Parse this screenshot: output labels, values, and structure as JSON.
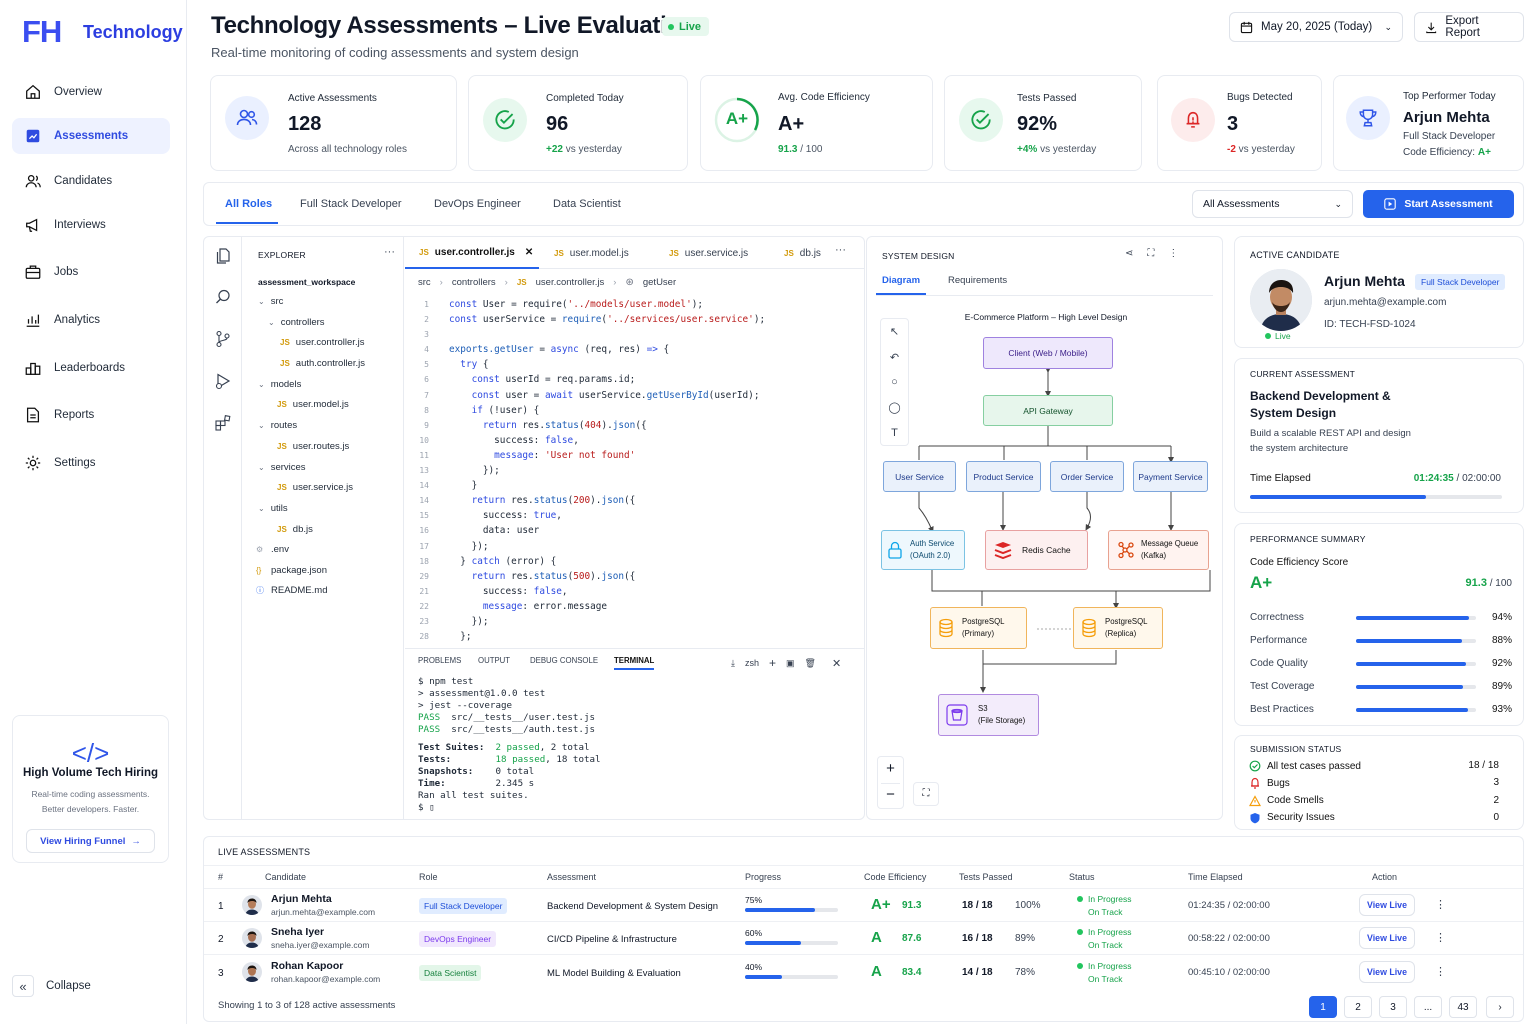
{
  "brand": {
    "logo_letters": "FH",
    "name": "Technology"
  },
  "sidebar": {
    "items": [
      {
        "label": "Overview",
        "icon": "home-icon"
      },
      {
        "label": "Assessments",
        "icon": "assessments-icon"
      },
      {
        "label": "Candidates",
        "icon": "users-icon"
      },
      {
        "label": "Interviews",
        "icon": "megaphone-icon"
      },
      {
        "label": "Jobs",
        "icon": "briefcase-icon"
      },
      {
        "label": "Analytics",
        "icon": "analytics-icon"
      },
      {
        "label": "Leaderboards",
        "icon": "leaderboard-icon"
      },
      {
        "label": "Reports",
        "icon": "report-icon"
      },
      {
        "label": "Settings",
        "icon": "gear-icon"
      }
    ],
    "promo": {
      "code": "</>",
      "title": "High Volume Tech Hiring",
      "line1": "Real-time coding assessments.",
      "line2": "Better developers. Faster.",
      "button": "View Hiring Funnel"
    },
    "collapse": "Collapse"
  },
  "header": {
    "title": "Technology Assessments – Live Evaluation",
    "live": "Live",
    "subtitle": "Real-time monitoring of coding assessments and system design",
    "date": "May 20, 2025 (Today)",
    "export": "Export Report"
  },
  "stats": {
    "active": {
      "label": "Active Assessments",
      "value": "128",
      "sub": "Across all technology roles"
    },
    "completed": {
      "label": "Completed Today",
      "value": "96",
      "delta": "+22",
      "sub": " vs yesterday"
    },
    "efficiency": {
      "label": "Avg. Code Efficiency",
      "value": "A+",
      "score": "91.3",
      "max": " / 100",
      "grade": "A+"
    },
    "tests": {
      "label": "Tests Passed",
      "value": "92%",
      "delta": "+4%",
      "sub": " vs yesterday"
    },
    "bugs": {
      "label": "Bugs Detected",
      "value": "3",
      "delta": "-2",
      "sub": " vs yesterday"
    },
    "top": {
      "label": "Top Performer Today",
      "name": "Arjun Mehta",
      "role": "Full Stack Developer",
      "eff_label": "Code Efficiency: ",
      "eff": "A+"
    }
  },
  "tabs": [
    "All Roles",
    "Full Stack Developer",
    "DevOps Engineer",
    "Data Scientist"
  ],
  "filter": "All Assessments",
  "start_btn": "Start Assessment",
  "explorer": {
    "title": "EXPLORER",
    "root": "assessment_workspace",
    "items": [
      {
        "t": "src",
        "kind": "folder",
        "lvl": 0
      },
      {
        "t": "controllers",
        "kind": "folder",
        "lvl": 1
      },
      {
        "t": "user.controller.js",
        "kind": "js",
        "lvl": 2
      },
      {
        "t": "auth.controller.js",
        "kind": "js",
        "lvl": 2
      },
      {
        "t": "models",
        "kind": "folder",
        "lvl": 0
      },
      {
        "t": "user.model.js",
        "kind": "js",
        "lvl": 1
      },
      {
        "t": "routes",
        "kind": "folder",
        "lvl": 0
      },
      {
        "t": "user.routes.js",
        "kind": "js",
        "lvl": 1
      },
      {
        "t": "services",
        "kind": "folder",
        "lvl": 0
      },
      {
        "t": "user.service.js",
        "kind": "js",
        "lvl": 1
      },
      {
        "t": "utils",
        "kind": "folder",
        "lvl": 0
      },
      {
        "t": "db.js",
        "kind": "js",
        "lvl": 1
      },
      {
        "t": ".env",
        "kind": "env",
        "lvl": -1
      },
      {
        "t": "package.json",
        "kind": "json",
        "lvl": -1
      },
      {
        "t": "README.md",
        "kind": "md",
        "lvl": -1
      }
    ]
  },
  "editor": {
    "tabs": [
      "user.controller.js",
      "user.model.js",
      "user.service.js",
      "db.js"
    ],
    "js_badge": "JS",
    "crumbs": [
      "src",
      "controllers",
      "user.controller.js",
      "getUser"
    ],
    "lines": [
      {
        "n": "1",
        "h": "<span class='kw'>const</span> User = require(<span class='st'>'../models/user.model'</span>);"
      },
      {
        "n": "2",
        "h": "<span class='kw'>const</span> userService = <span class='fn'>require</span>(<span class='st'>'../services/user.service'</span>);"
      },
      {
        "n": "3",
        "h": ""
      },
      {
        "n": "4",
        "h": "<span class='fn'>exports.getUser</span> = <span class='kw'>async</span> (req, res) <span class='kw'>=&gt;</span> {"
      },
      {
        "n": "5",
        "h": "  <span class='kw'>try</span> {"
      },
      {
        "n": "6",
        "h": "    <span class='kw'>const</span> userId = req.params.id;"
      },
      {
        "n": "7",
        "h": "    <span class='kw'>const</span> user = <span class='kw'>await</span> userService.<span class='fn'>getUserById</span>(userId);"
      },
      {
        "n": "8",
        "h": "    <span class='kw'>if</span> (!user) {"
      },
      {
        "n": "9",
        "h": "      <span class='kw'>return</span> res.<span class='fn'>status</span>(<span class='num'>404</span>).<span class='fn'>json</span>({"
      },
      {
        "n": "10",
        "h": "        success: <span class='kw'>false</span>,"
      },
      {
        "n": "11",
        "h": "        <span class='kw'>message</span>: <span class='st'>'User not found'</span>"
      },
      {
        "n": "13",
        "h": "      });"
      },
      {
        "n": "14",
        "h": "    }"
      },
      {
        "n": "14",
        "h": "    <span class='kw'>return</span> res.<span class='fn'>status</span>(<span class='num'>200</span>).<span class='fn'>json</span>({"
      },
      {
        "n": "15",
        "h": "      success: <span class='kw'>true</span>,"
      },
      {
        "n": "16",
        "h": "      data: user"
      },
      {
        "n": "17",
        "h": "    });"
      },
      {
        "n": "18",
        "h": "  } <span class='kw'>catch</span> (error) {"
      },
      {
        "n": "29",
        "h": "    <span class='kw'>return</span> res.<span class='fn'>status</span>(<span class='num'>500</span>).<span class='fn'>json</span>({"
      },
      {
        "n": "21",
        "h": "      success: <span class='kw'>false</span>,"
      },
      {
        "n": "22",
        "h": "      <span class='kw'>message</span>: error.message"
      },
      {
        "n": "23",
        "h": "    });"
      },
      {
        "n": "28",
        "h": "  };"
      }
    ]
  },
  "terminal": {
    "tabs": [
      "PROBLEMS",
      "OUTPUT",
      "DEBUG CONSOLE",
      "TERMINAL"
    ],
    "shell": "zsh",
    "lines": [
      "$ npm test",
      "> assessment@1.0.0 test",
      "> jest --coverage",
      "<span class='green' style='font-weight:400'>PASS</span>  src/__tests__/user.test.js",
      "<span class='green' style='font-weight:400'>PASS</span>  src/__tests__/auth.test.js",
      "",
      "<b>Test Suites:</b>  <span class='green' style='font-weight:400'>2 passed</span>, 2 total",
      "<b>Tests:</b>        <span class='green' style='font-weight:400'>18 passed</span>, 18 total",
      "<b>Snapshots:</b>    0 total",
      "<b>Time:</b>         2.345 s",
      "Ran all test suites.",
      "$ ▯"
    ]
  },
  "design": {
    "title": "SYSTEM DESIGN",
    "tabs": [
      "Diagram",
      "Requirements"
    ],
    "diagram_title": "E-Commerce Platform – High Level Design",
    "client": "Client (Web / Mobile)",
    "gateway": "API Gateway",
    "services": [
      "User Service",
      "Product Service",
      "Order Service",
      "Payment Service"
    ],
    "auth": [
      "Auth Service",
      "(OAuth 2.0)"
    ],
    "redis": "Redis Cache",
    "mq": [
      "Message Queue",
      "(Kafka)"
    ],
    "pg1": [
      "PostgreSQL",
      "(Primary)"
    ],
    "pg2": [
      "PostgreSQL",
      "(Replica)"
    ],
    "s3": [
      "S3",
      "(File Storage)"
    ]
  },
  "candidate": {
    "title": "ACTIVE CANDIDATE",
    "name": "Arjun Mehta",
    "role": "Full Stack Developer",
    "email": "arjun.mehta@example.com",
    "id": "ID: TECH-FSD-1024",
    "status": "Live"
  },
  "current": {
    "title": "CURRENT ASSESSMENT",
    "name1": "Backend Development &",
    "name2": "System Design",
    "desc1": "Build a scalable REST API and design",
    "desc2": "the system architecture",
    "time_label": "Time Elapsed",
    "elapsed": "01:24:35",
    "total": " / 02:00:00",
    "progress": 0.7
  },
  "performance": {
    "title": "PERFORMANCE SUMMARY",
    "score_label": "Code Efficiency Score",
    "grade": "A+",
    "score": "91.3",
    "max": " / 100",
    "metrics": [
      {
        "label": "Correctness",
        "value": "94%",
        "pct": 94
      },
      {
        "label": "Performance",
        "value": "88%",
        "pct": 88
      },
      {
        "label": "Code Quality",
        "value": "92%",
        "pct": 92
      },
      {
        "label": "Test Coverage",
        "value": "89%",
        "pct": 89
      },
      {
        "label": "Best Practices",
        "value": "93%",
        "pct": 93
      }
    ]
  },
  "submission": {
    "title": "SUBMISSION STATUS",
    "items": [
      {
        "label": "All test cases passed",
        "value": "18 / 18",
        "icon": "check-circle-icon",
        "color": "#16a34a"
      },
      {
        "label": "Bugs",
        "value": "3",
        "icon": "bug-icon",
        "color": "#dc2626"
      },
      {
        "label": "Code Smells",
        "value": "2",
        "icon": "warning-icon",
        "color": "#f59e0b"
      },
      {
        "label": "Security Issues",
        "value": "0",
        "icon": "shield-icon",
        "color": "#2563eb"
      }
    ]
  },
  "live_table": {
    "title": "LIVE ASSESSMENTS",
    "headers": [
      "#",
      "Candidate",
      "Role",
      "Assessment",
      "Progress",
      "Code Efficiency",
      "Tests Passed",
      "Status",
      "Time Elapsed",
      "Action"
    ],
    "rows": [
      {
        "n": "1",
        "name": "Arjun Mehta",
        "email": "arjun.mehta@example.com",
        "role": "Full Stack Developer",
        "role_bg": "#e0ecff",
        "role_fg": "#1d4ed8",
        "assessment": "Backend Development & System Design",
        "progress": "75%",
        "pct": 75,
        "grade": "A+",
        "score": "91.3",
        "tests": "18 / 18",
        "tests_pct": "100%",
        "status1": "In Progress",
        "status2": "On Track",
        "time": "01:24:35 / 02:00:00",
        "action": "View Live"
      },
      {
        "n": "2",
        "name": "Sneha Iyer",
        "email": "sneha.iyer@example.com",
        "role": "DevOps Engineer",
        "role_bg": "#f1e8fd",
        "role_fg": "#7c3aed",
        "assessment": "CI/CD Pipeline & Infrastructure",
        "progress": "60%",
        "pct": 60,
        "grade": "A",
        "score": "87.6",
        "tests": "16 / 18",
        "tests_pct": "89%",
        "status1": "In Progress",
        "status2": "On Track",
        "time": "00:58:22 / 02:00:00",
        "action": "View Live"
      },
      {
        "n": "3",
        "name": "Rohan Kapoor",
        "email": "rohan.kapoor@example.com",
        "role": "Data Scientist",
        "role_bg": "#e3f6e9",
        "role_fg": "#15803d",
        "assessment": "ML Model Building & Evaluation",
        "progress": "40%",
        "pct": 40,
        "grade": "A",
        "score": "83.4",
        "tests": "14 / 18",
        "tests_pct": "78%",
        "status1": "In Progress",
        "status2": "On Track",
        "time": "00:45:10 / 02:00:00",
        "action": "View Live"
      }
    ],
    "footer": "Showing 1 to 3 of 128 active assessments",
    "pages": [
      "1",
      "2",
      "3",
      "...",
      "43"
    ]
  }
}
